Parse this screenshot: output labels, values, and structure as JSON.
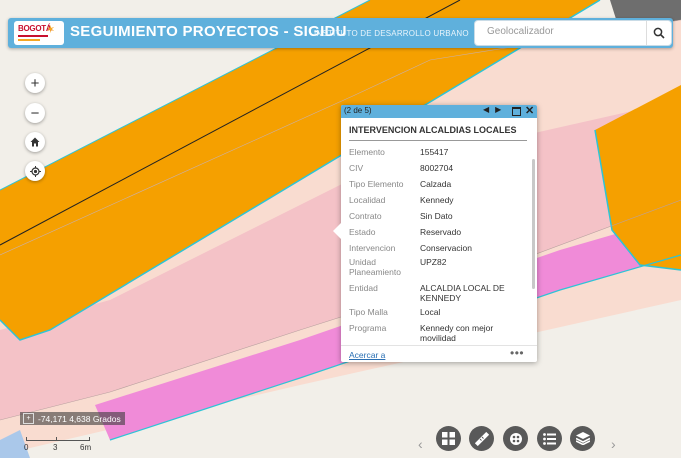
{
  "header": {
    "logo_text": "BOGOTÁ",
    "title": "SEGUIMIENTO PROYECTOS - SIGIDU",
    "subtitle": "INSTITUTO DE DESARROLLO URBANO",
    "search_placeholder": "Geolocalizador"
  },
  "map_controls": {
    "zoom_in": "+",
    "zoom_out": "−",
    "home_icon": "home-icon",
    "locate_icon": "locate-icon"
  },
  "popup": {
    "count": "(2 de 5)",
    "title": "INTERVENCION ALCALDIAS LOCALES",
    "rows": [
      {
        "label": "Elemento",
        "value": "155417"
      },
      {
        "label": "CIV",
        "value": "8002704"
      },
      {
        "label": "Tipo Elemento",
        "value": "Calzada"
      },
      {
        "label": "Localidad",
        "value": "Kennedy"
      },
      {
        "label": "Contrato",
        "value": "Sin Dato"
      },
      {
        "label": "Estado",
        "value": "Reservado"
      },
      {
        "label": "Intervencion",
        "value": "Conservacion"
      },
      {
        "label": "Unidad Planeamiento",
        "value": "UPZ82"
      },
      {
        "label": "Entidad",
        "value": "ALCALDIA LOCAL DE KENNEDY"
      },
      {
        "label": "Tipo Malla",
        "value": "Local"
      },
      {
        "label": "Programa",
        "value": "Kennedy con mejor movilidad"
      }
    ],
    "zoom_link": "Acercar a",
    "more": "•••"
  },
  "coordinates": "-74,171 4,638 Grados",
  "scale": {
    "labels": [
      "0",
      "3",
      "6m"
    ]
  },
  "toolbar": {
    "items": [
      "basemap-gallery-icon",
      "measure-icon",
      "layer-filter-icon",
      "legend-icon",
      "layers-icon"
    ]
  },
  "colors": {
    "header": "#5fb0dc",
    "road_orange": "#f5a000",
    "zone_pink": "#f4c2c7",
    "zone_peach": "#f9dcd0",
    "zone_magenta": "#f08bd8",
    "outline_cyan": "#2ec4d6",
    "toolbar": "#595959"
  }
}
